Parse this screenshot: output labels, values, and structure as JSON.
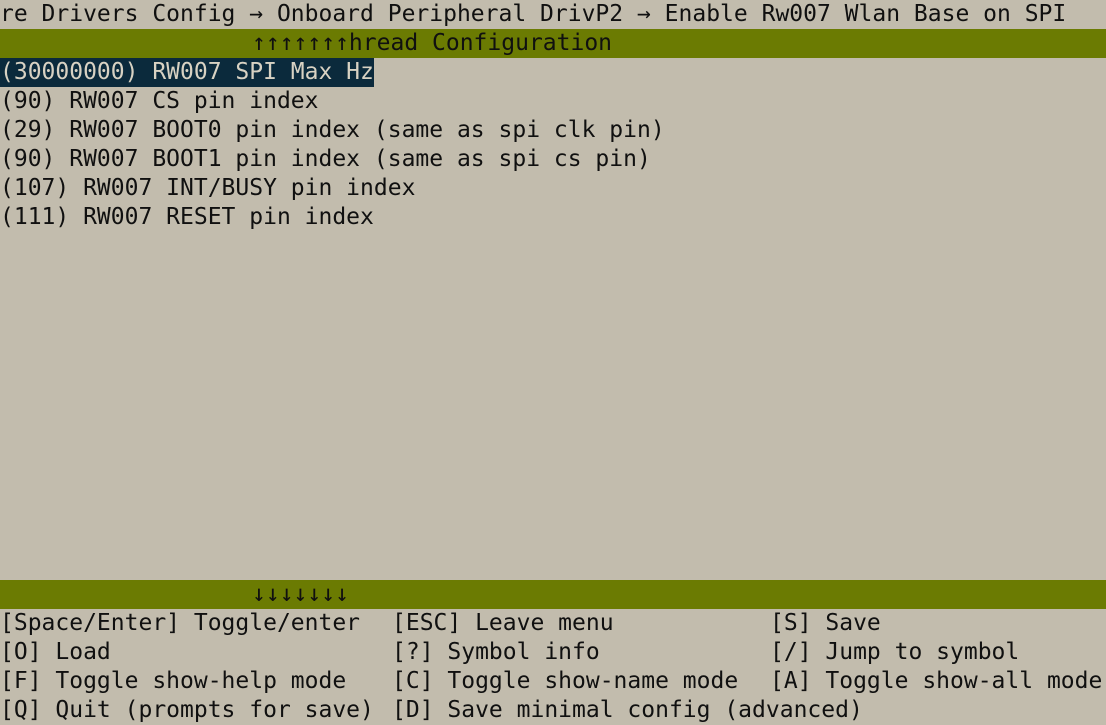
{
  "breadcrumb": "re Drivers Config → Onboard Peripheral DrivP2 → Enable Rw007 Wlan Base on SPI",
  "top_bar": {
    "text": "↑↑↑↑↑↑↑hread Configuration"
  },
  "menu": {
    "items": [
      {
        "label": "(30000000) RW007 SPI Max Hz",
        "selected": true
      },
      {
        "label": "(90) RW007 CS pin index",
        "selected": false
      },
      {
        "label": "(29) RW007 BOOT0 pin index (same as spi clk pin)",
        "selected": false
      },
      {
        "label": "(90) RW007 BOOT1 pin index (same as spi cs pin)",
        "selected": false
      },
      {
        "label": "(107) RW007 INT/BUSY pin index",
        "selected": false
      },
      {
        "label": "(111) RW007 RESET pin index",
        "selected": false
      }
    ]
  },
  "bottom_bar": {
    "text": "↓↓↓↓↓↓↓"
  },
  "help": {
    "space_enter": "[Space/Enter] Toggle/enter",
    "esc": "[ESC] Leave menu",
    "save": "[S] Save",
    "load": "[O] Load",
    "symbol_info": "[?] Symbol info",
    "jump": "[/] Jump to symbol",
    "toggle_help": "[F] Toggle show-help mode",
    "toggle_name": "[C] Toggle show-name mode",
    "toggle_all": "[A] Toggle show-all mode",
    "quit": "[Q] Quit (prompts for save)",
    "save_minimal": "[D] Save minimal config (advanced)"
  },
  "colors": {
    "background": "#c2bcad",
    "bar": "#6b7b02",
    "selected_bg": "#0b2a3c",
    "selected_fg": "#d8d2c3"
  }
}
